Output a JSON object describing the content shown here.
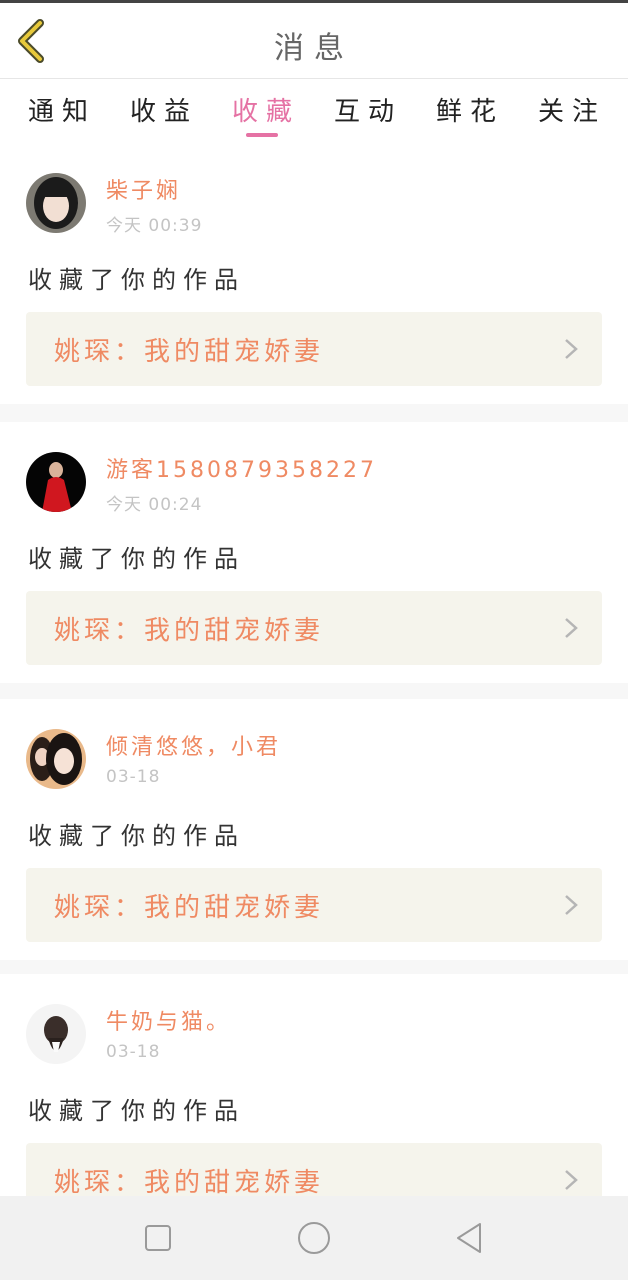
{
  "header": {
    "title": "消息"
  },
  "tabs": [
    {
      "label": "通知",
      "active": false
    },
    {
      "label": "收益",
      "active": false
    },
    {
      "label": "收藏",
      "active": true
    },
    {
      "label": "互动",
      "active": false
    },
    {
      "label": "鲜花",
      "active": false
    },
    {
      "label": "关注",
      "active": false
    }
  ],
  "feed": [
    {
      "user": "柴子娴",
      "time": "今天 00:39",
      "action": "收藏了你的作品",
      "work": "姚琛：我的甜宠娇妻"
    },
    {
      "user": "游客15808793582​27",
      "time": "今天 00:24",
      "action": "收藏了你的作品",
      "work": "姚琛：我的甜宠娇妻"
    },
    {
      "user": "倾清悠悠，小君",
      "time": "03-18",
      "action": "收藏了你的作品",
      "work": "姚琛：我的甜宠娇妻"
    },
    {
      "user": "牛奶与猫。",
      "time": "03-18",
      "action": "收藏了你的作品",
      "work": "姚琛：我的甜宠娇妻"
    }
  ],
  "colors": {
    "accent_pink": "#e572a4",
    "accent_orange": "#ef8a63",
    "card_link_bg": "#f5f4ec"
  },
  "icons": {
    "back": "chevron-left-icon",
    "item_arrow": "chevron-right-icon",
    "nav": [
      "square-icon",
      "circle-icon",
      "triangle-back-icon"
    ]
  }
}
